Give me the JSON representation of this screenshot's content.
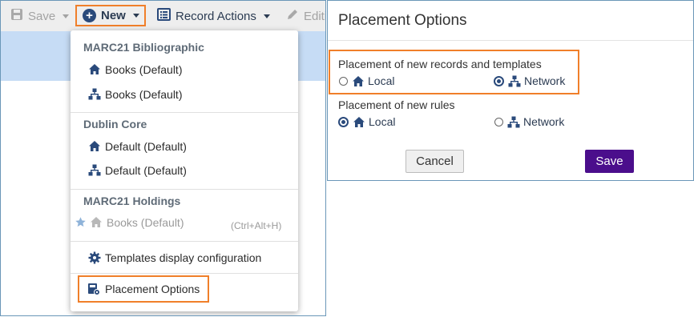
{
  "toolbar": {
    "save_label": "Save",
    "new_label": "New",
    "new_icon": "plus-circle-icon",
    "record_actions_label": "Record Actions",
    "edit_label": "Editi"
  },
  "new_menu": {
    "groups": [
      {
        "header": "MARC21 Bibliographic",
        "items": [
          {
            "label": "Books (Default)",
            "icon": "house-icon"
          },
          {
            "label": "Books (Default)",
            "icon": "network-icon"
          }
        ]
      },
      {
        "header": "Dublin Core",
        "items": [
          {
            "label": "Default (Default)",
            "icon": "house-icon"
          },
          {
            "label": "Default (Default)",
            "icon": "network-icon"
          }
        ]
      },
      {
        "header": "MARC21 Holdings",
        "items": [
          {
            "label": "Books (Default)",
            "icon": "house-icon",
            "shortcut": "(Ctrl+Alt+H)",
            "starred": true
          }
        ]
      }
    ],
    "templates_config_label": "Templates display configuration",
    "placement_options_label": "Placement Options"
  },
  "dialog": {
    "title": "Placement Options",
    "records_group_label": "Placement of new records and templates",
    "rules_group_label": "Placement of new rules",
    "local_label": "Local",
    "network_label": "Network",
    "records_selected": "Network",
    "rules_selected": "Local",
    "cancel_label": "Cancel",
    "save_label": "Save"
  },
  "colors": {
    "highlight": "#f07f2a",
    "primary_blue": "#2a4a7b",
    "save_purple": "#4b0e8c",
    "band_blue": "#c6dcf5"
  }
}
